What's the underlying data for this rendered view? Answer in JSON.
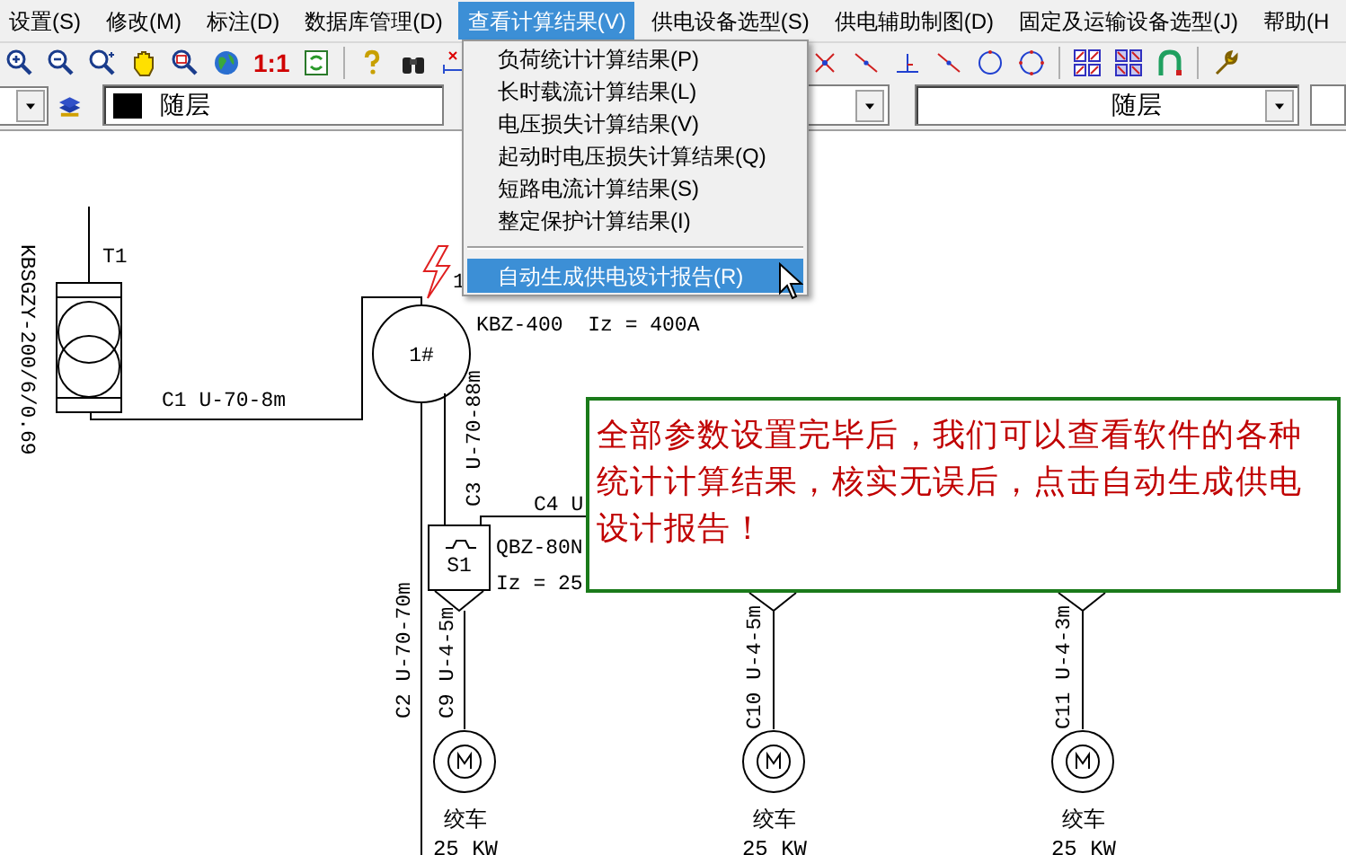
{
  "menu_bar": [
    {
      "label": "设置(S)",
      "selected": false
    },
    {
      "label": "修改(M)",
      "selected": false
    },
    {
      "label": "标注(D)",
      "selected": false
    },
    {
      "label": "数据库管理(D)",
      "selected": false
    },
    {
      "label": "查看计算结果(V)",
      "selected": true
    },
    {
      "label": "供电设备选型(S)",
      "selected": false
    },
    {
      "label": "供电辅助制图(D)",
      "selected": false
    },
    {
      "label": "固定及运输设备选型(J)",
      "selected": false
    },
    {
      "label": "帮助(H",
      "selected": false
    }
  ],
  "toolbar": {
    "scale_label": "1:1"
  },
  "layer_bar": {
    "color_field": "随层",
    "linetype_field": "随层"
  },
  "dropdown_menu": [
    {
      "label": "负荷统计计算结果(P)",
      "selected": false,
      "separator_before": false
    },
    {
      "label": "长时载流计算结果(L)",
      "selected": false,
      "separator_before": false
    },
    {
      "label": "电压损失计算结果(V)",
      "selected": false,
      "separator_before": false
    },
    {
      "label": "起动时电压损失计算结果(Q)",
      "selected": false,
      "separator_before": false
    },
    {
      "label": "短路电流计算结果(S)",
      "selected": false,
      "separator_before": false
    },
    {
      "label": "整定保护计算结果(I)",
      "selected": false,
      "separator_before": false
    },
    {
      "label": "自动生成供电设计报告(R)",
      "selected": true,
      "separator_before": true
    }
  ],
  "diagram": {
    "labels": [
      {
        "text": "T1"
      },
      {
        "text": "KBSGZY-200/6/0.69"
      },
      {
        "text": "C1 U-70-8m"
      },
      {
        "text": "1#"
      },
      {
        "text": "1"
      },
      {
        "text": "KBZ-400  Iz = 400A"
      },
      {
        "text": "C3 U-70-88m"
      },
      {
        "text": "C4 U"
      },
      {
        "text": "QBZ-80N"
      },
      {
        "text": "Iz = 25"
      },
      {
        "text": "S1"
      },
      {
        "text": "C2 U-70-70m"
      },
      {
        "text": "C9 U-4-5m"
      },
      {
        "text": "C10 U-4-5m"
      },
      {
        "text": "C11 U-4-3m"
      }
    ],
    "motors": [
      {
        "name": "绞车",
        "power": "25 KW"
      },
      {
        "name": "绞车",
        "power": "25 KW"
      },
      {
        "name": "绞车",
        "power": "25 KW"
      }
    ]
  },
  "note": {
    "text": "全部参数设置完毕后，我们可以查看软件的各种统计计算结果，核实无误后，点击自动生成供电设计报告！"
  }
}
